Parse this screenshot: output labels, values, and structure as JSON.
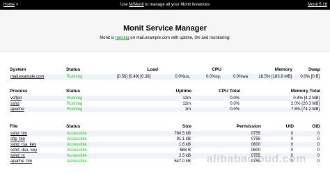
{
  "topbar": {
    "home_label": "Home",
    "home_sep": ">",
    "center_prefix": "Use ",
    "center_link": "M/Monit",
    "center_suffix": " to manage all your Monit instances",
    "version": "Monit 5.16"
  },
  "header": {
    "title": "Monit Service Manager",
    "sub_1": "Monit is ",
    "sub_running": "running",
    "sub_2": " on mail.example.com with ",
    "sub_uptime": "uptime, 0m",
    "sub_3": " and monitoring:"
  },
  "system_table": {
    "headers": [
      "System",
      "Status",
      "Load",
      "CPU",
      "Memory",
      "Swap"
    ],
    "rows": [
      {
        "name": "mail.example.com",
        "status": "Running",
        "load": "[0.56] [0.49] [0.38]",
        "cpu1": "0.0%us,",
        "cpu2": "0.0%sy,",
        "cpu3": "0.0%wa",
        "memory": "18.5% [183.6 MB]",
        "swap": "0.0% [0 B]"
      }
    ]
  },
  "process_table": {
    "headers": [
      "Process",
      "Status",
      "Uptime",
      "CPU Total",
      "Memory Total"
    ],
    "rows": [
      {
        "name": "vsftpd",
        "status": "Running",
        "uptime": "12m",
        "cpu": "0.0%",
        "memory": "0.4% [4.2 MB]"
      },
      {
        "name": "sshd",
        "status": "Running",
        "uptime": "12m",
        "cpu": "0.0%",
        "memory": "2.0% [20.3 MB]"
      },
      {
        "name": "apache",
        "status": "Running",
        "uptime": "1m",
        "cpu": "0.0%",
        "memory": "7.5% [74.2 MB]"
      }
    ]
  },
  "file_table": {
    "headers": [
      "File",
      "Status",
      "Size",
      "Permission",
      "UID",
      "GID"
    ],
    "rows": [
      {
        "name": "sshd_bin",
        "status": "Accessible",
        "size": "780.5 kB",
        "perm": "0755",
        "uid": "0",
        "gid": "0"
      },
      {
        "name": "sftp_bin",
        "status": "Accessible",
        "size": "91.1 kB",
        "perm": "0755",
        "uid": "0",
        "gid": "0"
      },
      {
        "name": "sshd_rsa_key",
        "status": "Accessible",
        "size": "1.6 kB",
        "perm": "0600",
        "uid": "0",
        "gid": "0"
      },
      {
        "name": "sshd_dsa_key",
        "status": "Accessible",
        "size": "668 B",
        "perm": "0600",
        "uid": "0",
        "gid": "0"
      },
      {
        "name": "sshd_rc",
        "status": "Accessible",
        "size": "2.5 kB",
        "perm": "0755",
        "uid": "0",
        "gid": "0"
      },
      {
        "name": "apache_bin",
        "status": "Accessible",
        "size": "647.0 kB",
        "perm": "0755",
        "uid": "0",
        "gid": "0"
      }
    ]
  },
  "watermark": "alibabacloud.com",
  "colors": {
    "topbar": "#000000",
    "running": "#22cc22",
    "header_bg": "#f6f6f6",
    "row_alt": "#f2f3f8"
  }
}
